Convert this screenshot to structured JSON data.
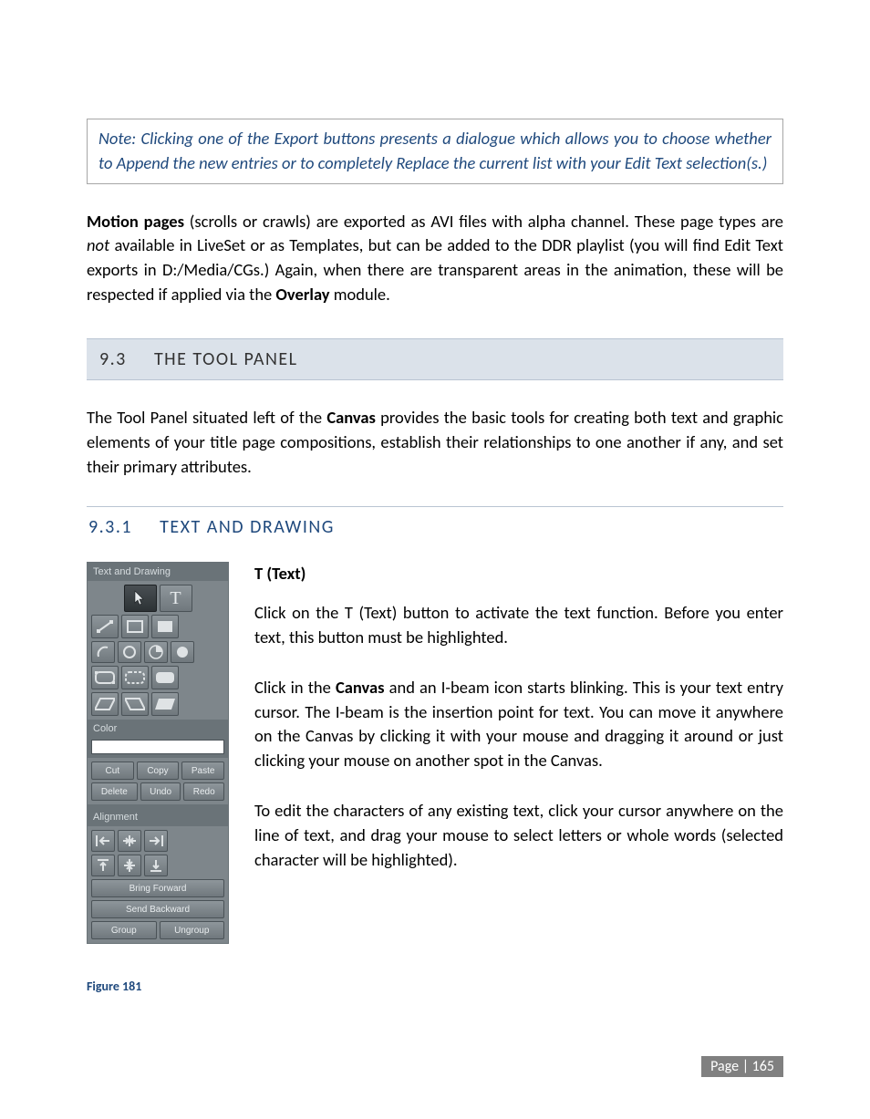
{
  "note": "Note: Clicking one of the Export buttons presents a dialogue which allows you to choose whether to Append the new entries or to completely Replace the current list with your Edit Text selection(s.)",
  "p_motion_html": "<b>Motion pages</b> (scrolls or crawls) are exported as AVI files with alpha channel.  These page types are <i>not</i> available in LiveSet or as Templates, but can be added to the DDR playlist (you will find Edit Text exports in D:/Media/CGs.)  Again, when there are transparent areas in the animation, these will be respected if applied via the <b>Overlay</b> module.",
  "sec93": {
    "num": "9.3",
    "title": "THE TOOL PANEL"
  },
  "p_toolpanel_html": "The Tool Panel situated left of the <b>Canvas</b> provides the basic tools for creating both text and graphic elements of your title page compositions, establish their relationships to one another if any, and set their primary attributes.",
  "sec931": {
    "num": "9.3.1",
    "title": "TEXT AND DRAWING"
  },
  "ttext_heading": "T (Text)",
  "p_t1": "Click on the T (Text) button to activate the text function. Before you enter text, this button must be highlighted.",
  "p_t2_html": "Click in the <b>Canvas</b> and an I-beam icon starts blinking. This is your text entry cursor. The I-beam is the insertion point for text. You can move it anywhere on the Canvas by clicking it with your mouse and dragging it around or just clicking your mouse on another spot in the Canvas.",
  "p_t3": "To edit the characters of any existing text, click your cursor anywhere on the line of text, and drag your mouse to select letters or whole words (selected character will be highlighted).",
  "fig": "Figure 181",
  "page_label": "Page | 165",
  "panel": {
    "header_text_drawing": "Text and Drawing",
    "header_color": "Color",
    "header_alignment": "Alignment",
    "text_T": "T",
    "cut": "Cut",
    "copy": "Copy",
    "paste": "Paste",
    "delete": "Delete",
    "undo": "Undo",
    "redo": "Redo",
    "bring_forward": "Bring Forward",
    "send_backward": "Send Backward",
    "group": "Group",
    "ungroup": "Ungroup"
  }
}
